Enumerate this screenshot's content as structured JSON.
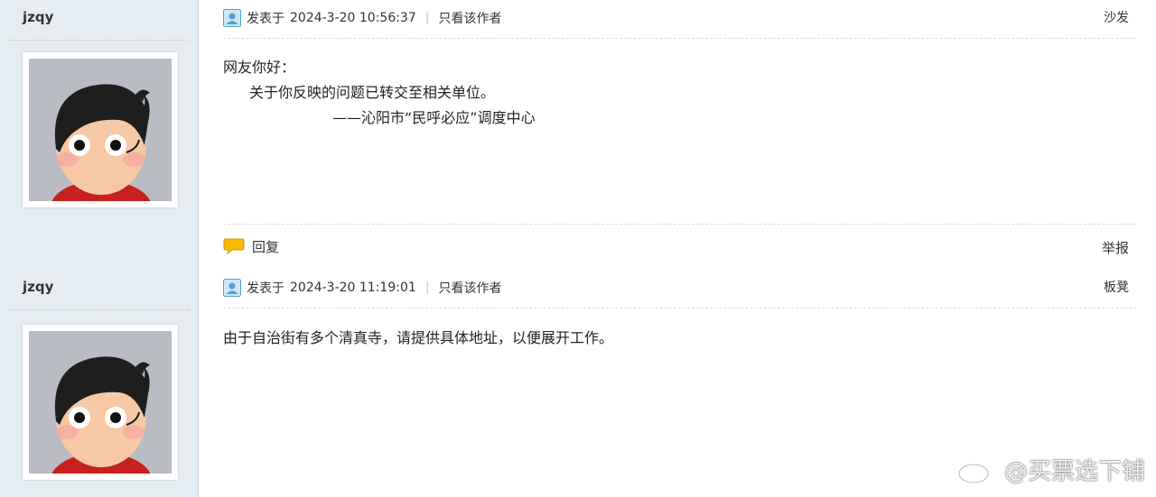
{
  "posts": [
    {
      "username": "jzqy",
      "posted_prefix": "发表于",
      "posted_time": "2024-3-20 10:56:37",
      "only_author": "只看该作者",
      "floor": "沙发",
      "content": {
        "line1": "网友你好：",
        "line2": "关于你反映的问题已转交至相关单位。",
        "line3": "——沁阳市“民呼必应”调度中心"
      },
      "reply_label": "回复",
      "report_label": "举报"
    },
    {
      "username": "jzqy",
      "posted_prefix": "发表于",
      "posted_time": "2024-3-20 11:19:01",
      "only_author": "只看该作者",
      "floor": "板凳",
      "content": {
        "line1": "由于自治街有多个清真寺，请提供具体地址，以便展开工作。"
      }
    }
  ],
  "watermark": "@买票选下铺",
  "icons": {
    "user": "user-icon",
    "reply": "speech-bubble-icon",
    "watermark": "weibo-logo-icon"
  },
  "colors": {
    "sidebar_bg": "#e5edf2",
    "reply_icon": "#f6b800"
  }
}
